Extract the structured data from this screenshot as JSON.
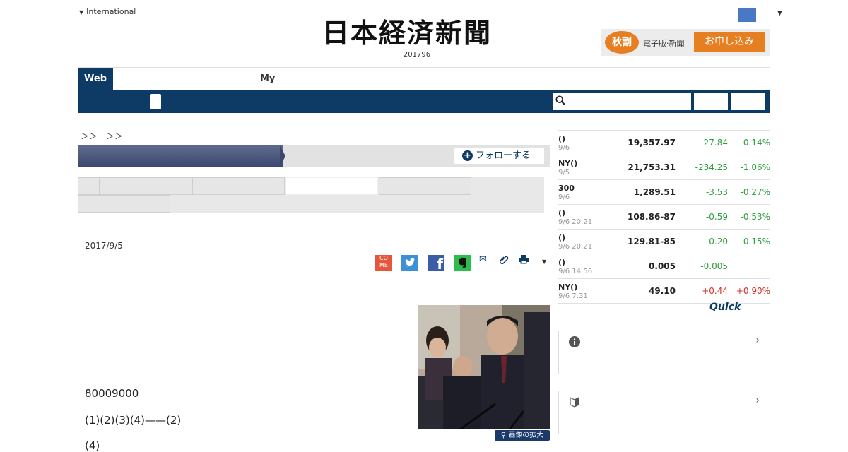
{
  "header": {
    "international_label": "International",
    "masthead": "日本経済新聞",
    "masthead_number": "201796",
    "promo_badge": "秋割",
    "promo_text": "電子版·新聞",
    "promo_button": "お申し込み"
  },
  "nav": {
    "tab_web": "Web",
    "tab_my": "My",
    "search_placeholder": ""
  },
  "breadcrumb": "＞＞　＞＞",
  "section": {
    "follow_label": "フォローする"
  },
  "article": {
    "date": "2017/9/5",
    "paragraph1": "80009000",
    "paragraph2": "(1)(2)(3)(4)——(2)",
    "paragraph3": "(4)",
    "enlarge_label": "画像の拡大"
  },
  "share_icons": [
    "come-icon",
    "twitter-icon",
    "facebook-icon",
    "evernote-icon",
    "mail-icon",
    "clip-icon",
    "print-icon",
    "more-icon"
  ],
  "market": {
    "rows": [
      {
        "name": "()",
        "time": "9/6",
        "value": "19,357.97",
        "change": "-27.84",
        "pct": "-0.14%",
        "dir": "neg"
      },
      {
        "name": "NY()",
        "time": "9/5",
        "value": "21,753.31",
        "change": "-234.25",
        "pct": "-1.06%",
        "dir": "neg"
      },
      {
        "name": "300",
        "time": "9/6",
        "value": "1,289.51",
        "change": "-3.53",
        "pct": "-0.27%",
        "dir": "neg"
      },
      {
        "name": "()",
        "time": "9/6 20:21",
        "value": "108.86-87",
        "change": "-0.59",
        "pct": "-0.53%",
        "dir": "neg"
      },
      {
        "name": "()",
        "time": "9/6 20:21",
        "value": "129.81-85",
        "change": "-0.20",
        "pct": "-0.15%",
        "dir": "neg"
      },
      {
        "name": "()",
        "time": "9/6 14:56",
        "value": "0.005",
        "change": "-0.005",
        "pct": "",
        "dir": "neg"
      },
      {
        "name": "NY()",
        "time": "9/6 7:31",
        "value": "49.10",
        "change": "+0.44",
        "pct": "+0.90%",
        "dir": "pos"
      }
    ],
    "quick_logo": "Quick"
  },
  "colors": {
    "navy": "#0d3b66",
    "negative": "#2e9e3e",
    "positive": "#d6322c",
    "promo": "#e67e22"
  }
}
